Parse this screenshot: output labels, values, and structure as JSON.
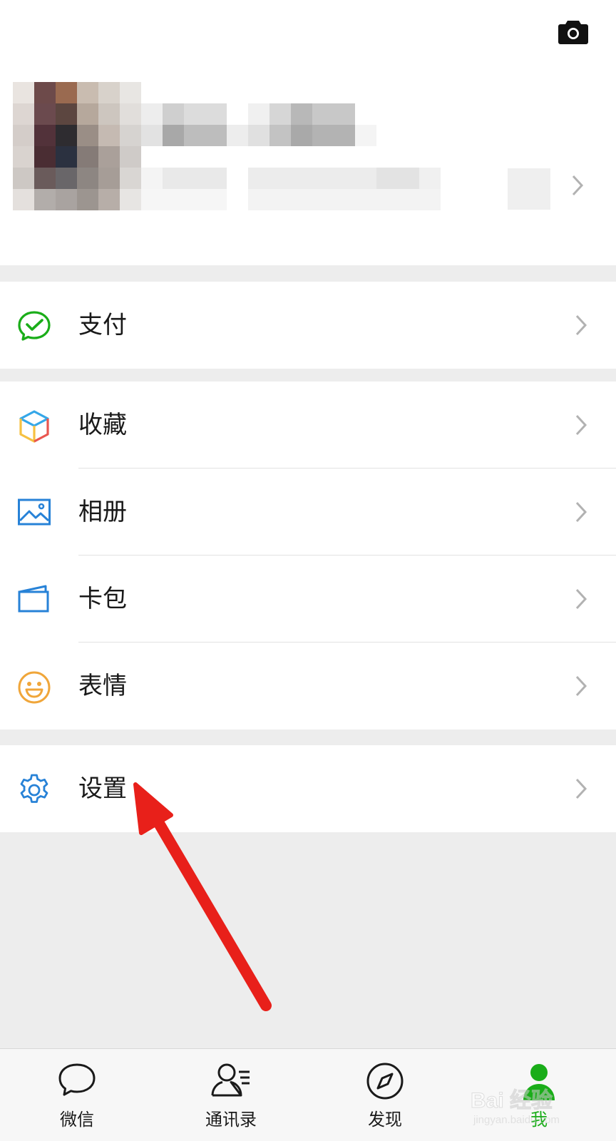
{
  "header": {
    "camera_icon": "camera-icon",
    "profile_chevron_icon": "chevron-right-icon"
  },
  "menu": {
    "pay": {
      "label": "支付",
      "icon": "wechat-pay-icon",
      "icon_color": "#1aad19"
    },
    "favorites": {
      "label": "收藏",
      "icon": "favorites-cube-icon"
    },
    "album": {
      "label": "相册",
      "icon": "album-image-icon",
      "icon_color": "#2782d7"
    },
    "cards": {
      "label": "卡包",
      "icon": "card-wallet-icon",
      "icon_color": "#2782d7"
    },
    "stickers": {
      "label": "表情",
      "icon": "smiley-icon",
      "icon_color": "#f0a63a"
    },
    "settings": {
      "label": "设置",
      "icon": "gear-icon",
      "icon_color": "#2782d7"
    }
  },
  "tabbar": {
    "tabs": [
      {
        "label": "微信",
        "icon": "chat-bubble-icon",
        "active": false
      },
      {
        "label": "通讯录",
        "icon": "contacts-icon",
        "active": false
      },
      {
        "label": "发现",
        "icon": "compass-icon",
        "active": false
      },
      {
        "label": "我",
        "icon": "me-person-icon",
        "active": true
      }
    ],
    "active_color": "#1aad19"
  },
  "annotation": {
    "arrow_color": "#e8201a",
    "watermark_brand": "Bai 经验",
    "watermark_url": "jingyan.baidu.com"
  }
}
